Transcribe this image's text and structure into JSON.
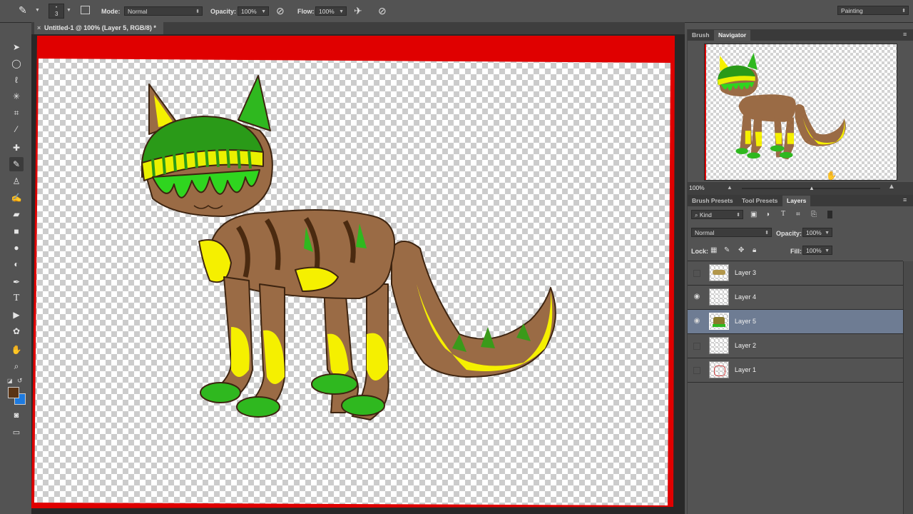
{
  "options_bar": {
    "brush_size": "3",
    "mode_label": "Mode:",
    "mode_value": "Normal",
    "opacity_label": "Opacity:",
    "opacity_value": "100%",
    "flow_label": "Flow:",
    "flow_value": "100%",
    "workspace_value": "Painting"
  },
  "document": {
    "tab_title": "Untitled-1 @ 100% (Layer 5, RGB/8) *"
  },
  "colors": {
    "foreground": "#5a3415",
    "background": "#1e7be0",
    "canvas_border": "#e00000",
    "selected_layer": "#6e7c93"
  },
  "tools": [
    "move-icon",
    "marquee-icon",
    "lasso-icon",
    "magic-wand-icon",
    "crop-icon",
    "eyedropper-icon",
    "spot-healing-icon",
    "brush-icon",
    "clone-stamp-icon",
    "history-brush-icon",
    "eraser-icon",
    "gradient-icon",
    "blur-icon",
    "dodge-icon",
    "pen-icon",
    "type-icon",
    "path-selection-icon",
    "shape-icon",
    "hand-icon",
    "zoom-icon"
  ],
  "navigator": {
    "tabs": [
      "Brush",
      "Navigator"
    ],
    "zoom_value": "100%"
  },
  "layers_panel": {
    "tabs": [
      "Brush Presets",
      "Tool Presets",
      "Layers"
    ],
    "filter_value": "Kind",
    "blend_mode": "Normal",
    "opacity_label": "Opacity:",
    "opacity_value": "100%",
    "lock_label": "Lock:",
    "fill_label": "Fill:",
    "fill_value": "100%",
    "layers": [
      {
        "name": "Layer 3",
        "visible": false,
        "selected": false
      },
      {
        "name": "Layer 4",
        "visible": true,
        "selected": false
      },
      {
        "name": "Layer 5",
        "visible": true,
        "selected": true
      },
      {
        "name": "Layer 2",
        "visible": false,
        "selected": false
      },
      {
        "name": "Layer 1",
        "visible": false,
        "selected": false
      }
    ]
  }
}
